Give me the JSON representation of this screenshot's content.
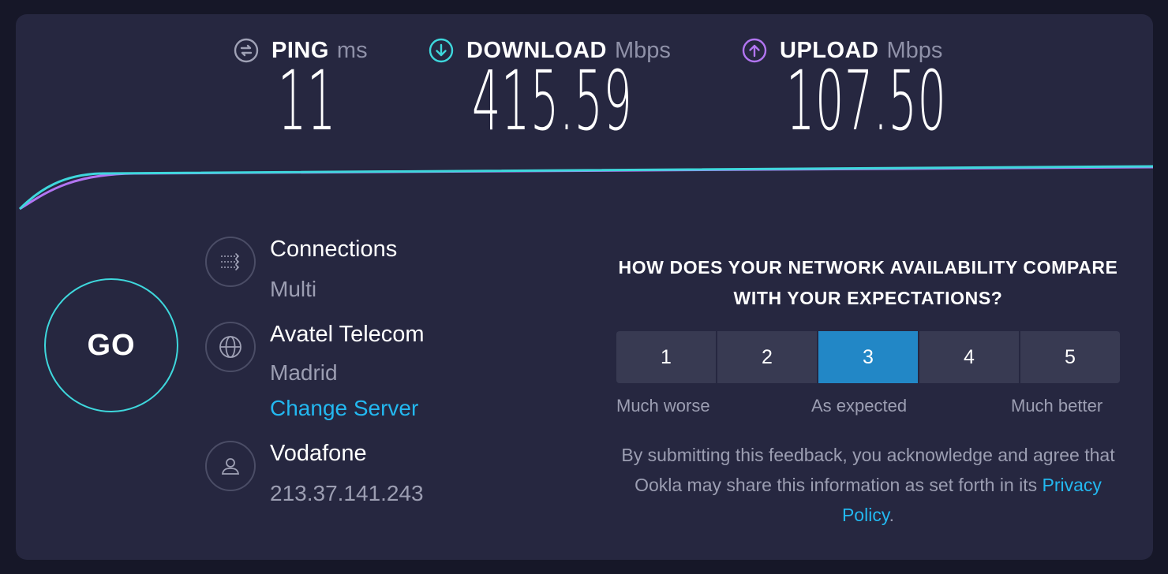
{
  "metrics": {
    "ping": {
      "label": "PING",
      "unit": "ms",
      "value": "11",
      "icon": "ping-icon",
      "color": "#9fa1b5"
    },
    "download": {
      "label": "DOWNLOAD",
      "unit": "Mbps",
      "value": "415.59",
      "icon": "download-arrow-icon",
      "color": "#3ed7dc"
    },
    "upload": {
      "label": "UPLOAD",
      "unit": "Mbps",
      "value": "107.50",
      "icon": "upload-arrow-icon",
      "color": "#b275f2"
    }
  },
  "go": {
    "label": "GO"
  },
  "connections": {
    "title": "Connections",
    "value": "Multi",
    "icon": "connections-icon"
  },
  "server": {
    "name": "Avatel Telecom",
    "location": "Madrid",
    "change_label": "Change Server",
    "icon": "globe-icon"
  },
  "isp": {
    "name": "Vodafone",
    "ip": "213.37.141.243",
    "icon": "user-icon"
  },
  "survey": {
    "question": "HOW DOES YOUR NETWORK AVAILABILITY COMPARE WITH YOUR EXPECTATIONS?",
    "options": [
      "1",
      "2",
      "3",
      "4",
      "5"
    ],
    "selected": "3",
    "scale_low": "Much worse",
    "scale_mid": "As expected",
    "scale_high": "Much better",
    "disclaimer": "By submitting this feedback, you acknowledge and agree that Ookla may share this information as set forth in its",
    "privacy_link": "Privacy Policy",
    "period": "."
  },
  "colors": {
    "background": "#161728",
    "card": "#262740",
    "download": "#3ed7dc",
    "upload": "#b275f2",
    "link": "#23b8f0",
    "selected": "#2287c6"
  }
}
